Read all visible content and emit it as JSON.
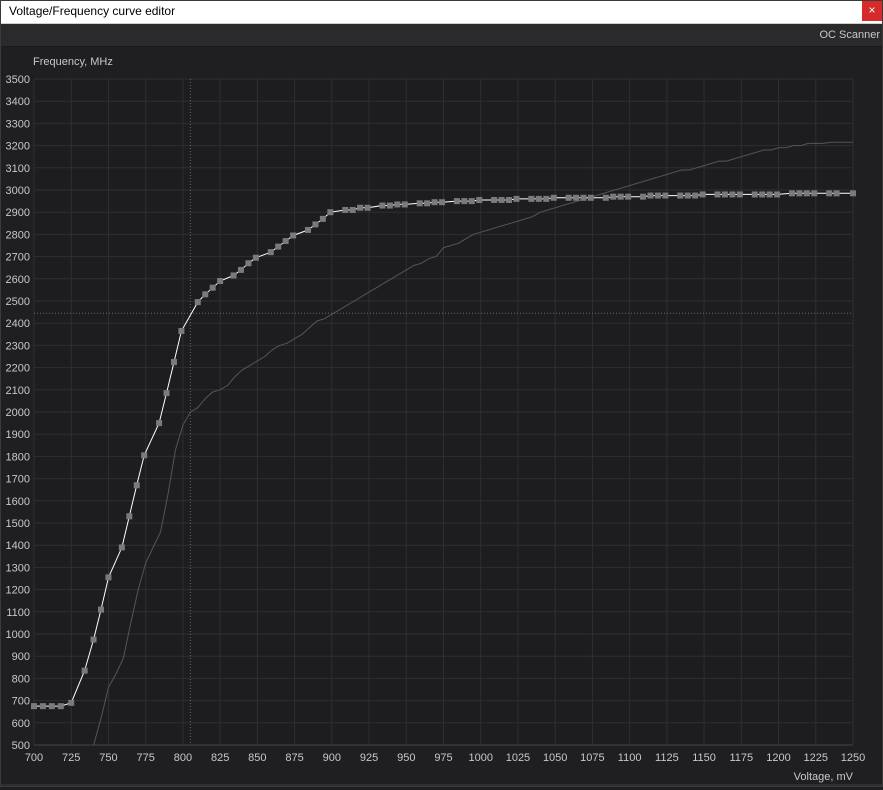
{
  "window": {
    "title": "Voltage/Frequency curve editor",
    "close_label": "×"
  },
  "toolbar": {
    "oc_scanner_label": "OC Scanner"
  },
  "colors": {
    "background": "#1f1f21",
    "grid": "#2f2f32",
    "curve": "#ffffff",
    "point": "#7a7a7a",
    "reference_curve": "#555555",
    "cursor_line": "#6a6a6a",
    "text": "#c8c8c8"
  },
  "chart_data": {
    "type": "line",
    "ylabel": "Frequency, MHz",
    "xlabel": "Voltage, mV",
    "xlim": [
      700,
      1250
    ],
    "ylim": [
      500,
      3500
    ],
    "xticks": [
      700,
      725,
      750,
      775,
      800,
      825,
      850,
      875,
      900,
      925,
      950,
      975,
      1000,
      1025,
      1050,
      1075,
      1100,
      1125,
      1150,
      1175,
      1200,
      1225,
      1250
    ],
    "yticks": [
      500,
      600,
      700,
      800,
      900,
      1000,
      1100,
      1200,
      1300,
      1400,
      1500,
      1600,
      1700,
      1800,
      1900,
      2000,
      2100,
      2200,
      2300,
      2400,
      2500,
      2600,
      2700,
      2800,
      2900,
      3000,
      3100,
      3200,
      3300,
      3400,
      3500
    ],
    "grid": true,
    "cursor": {
      "x": 805,
      "y": 2445
    },
    "series": [
      {
        "role": "curve",
        "markers": true,
        "points": [
          [
            700,
            675
          ],
          [
            706,
            675
          ],
          [
            712,
            675
          ],
          [
            718,
            675
          ],
          [
            725,
            690
          ],
          [
            734,
            835
          ],
          [
            740,
            975
          ],
          [
            745,
            1110
          ],
          [
            750,
            1255
          ],
          [
            759,
            1390
          ],
          [
            764,
            1530
          ],
          [
            769,
            1670
          ],
          [
            774,
            1805
          ],
          [
            784,
            1950
          ],
          [
            789,
            2085
          ],
          [
            794,
            2225
          ],
          [
            799,
            2365
          ],
          [
            810,
            2495
          ],
          [
            815,
            2530
          ],
          [
            820,
            2560
          ],
          [
            825,
            2590
          ],
          [
            834,
            2615
          ],
          [
            839,
            2640
          ],
          [
            844,
            2670
          ],
          [
            849,
            2695
          ],
          [
            859,
            2720
          ],
          [
            864,
            2745
          ],
          [
            869,
            2770
          ],
          [
            874,
            2795
          ],
          [
            884,
            2820
          ],
          [
            889,
            2845
          ],
          [
            894,
            2870
          ],
          [
            899,
            2900
          ],
          [
            909,
            2910
          ],
          [
            914,
            2910
          ],
          [
            919,
            2920
          ],
          [
            924,
            2920
          ],
          [
            934,
            2930
          ],
          [
            939,
            2930
          ],
          [
            944,
            2935
          ],
          [
            949,
            2935
          ],
          [
            959,
            2940
          ],
          [
            964,
            2940
          ],
          [
            969,
            2945
          ],
          [
            974,
            2945
          ],
          [
            984,
            2950
          ],
          [
            989,
            2950
          ],
          [
            994,
            2950
          ],
          [
            999,
            2955
          ],
          [
            1009,
            2955
          ],
          [
            1014,
            2955
          ],
          [
            1019,
            2955
          ],
          [
            1024,
            2960
          ],
          [
            1034,
            2960
          ],
          [
            1039,
            2960
          ],
          [
            1044,
            2960
          ],
          [
            1049,
            2965
          ],
          [
            1059,
            2965
          ],
          [
            1064,
            2965
          ],
          [
            1069,
            2965
          ],
          [
            1074,
            2965
          ],
          [
            1084,
            2965
          ],
          [
            1089,
            2970
          ],
          [
            1094,
            2970
          ],
          [
            1099,
            2970
          ],
          [
            1109,
            2970
          ],
          [
            1114,
            2975
          ],
          [
            1119,
            2975
          ],
          [
            1124,
            2975
          ],
          [
            1134,
            2975
          ],
          [
            1139,
            2975
          ],
          [
            1144,
            2975
          ],
          [
            1149,
            2980
          ],
          [
            1159,
            2980
          ],
          [
            1164,
            2980
          ],
          [
            1169,
            2980
          ],
          [
            1174,
            2980
          ],
          [
            1184,
            2980
          ],
          [
            1189,
            2980
          ],
          [
            1194,
            2980
          ],
          [
            1199,
            2980
          ],
          [
            1209,
            2985
          ],
          [
            1214,
            2985
          ],
          [
            1219,
            2985
          ],
          [
            1224,
            2985
          ],
          [
            1234,
            2985
          ],
          [
            1239,
            2985
          ],
          [
            1250,
            2985
          ]
        ]
      },
      {
        "role": "reference",
        "markers": false,
        "points": [
          [
            740,
            500
          ],
          [
            745,
            620
          ],
          [
            750,
            760
          ],
          [
            755,
            820
          ],
          [
            760,
            890
          ],
          [
            765,
            1050
          ],
          [
            770,
            1200
          ],
          [
            775,
            1320
          ],
          [
            780,
            1390
          ],
          [
            785,
            1460
          ],
          [
            790,
            1630
          ],
          [
            795,
            1830
          ],
          [
            800,
            1940
          ],
          [
            805,
            2000
          ],
          [
            810,
            2020
          ],
          [
            815,
            2060
          ],
          [
            820,
            2090
          ],
          [
            825,
            2100
          ],
          [
            830,
            2120
          ],
          [
            835,
            2160
          ],
          [
            840,
            2190
          ],
          [
            845,
            2210
          ],
          [
            850,
            2230
          ],
          [
            855,
            2250
          ],
          [
            860,
            2280
          ],
          [
            865,
            2300
          ],
          [
            870,
            2310
          ],
          [
            875,
            2330
          ],
          [
            880,
            2350
          ],
          [
            885,
            2380
          ],
          [
            890,
            2410
          ],
          [
            895,
            2420
          ],
          [
            900,
            2440
          ],
          [
            905,
            2460
          ],
          [
            910,
            2480
          ],
          [
            915,
            2500
          ],
          [
            920,
            2520
          ],
          [
            925,
            2540
          ],
          [
            930,
            2560
          ],
          [
            935,
            2580
          ],
          [
            940,
            2600
          ],
          [
            945,
            2620
          ],
          [
            950,
            2640
          ],
          [
            955,
            2660
          ],
          [
            960,
            2670
          ],
          [
            965,
            2690
          ],
          [
            970,
            2700
          ],
          [
            975,
            2740
          ],
          [
            980,
            2750
          ],
          [
            985,
            2760
          ],
          [
            990,
            2780
          ],
          [
            995,
            2800
          ],
          [
            1000,
            2810
          ],
          [
            1005,
            2820
          ],
          [
            1010,
            2830
          ],
          [
            1015,
            2840
          ],
          [
            1020,
            2850
          ],
          [
            1025,
            2860
          ],
          [
            1030,
            2870
          ],
          [
            1035,
            2880
          ],
          [
            1040,
            2900
          ],
          [
            1045,
            2910
          ],
          [
            1050,
            2920
          ],
          [
            1055,
            2930
          ],
          [
            1060,
            2940
          ],
          [
            1065,
            2950
          ],
          [
            1070,
            2960
          ],
          [
            1075,
            2970
          ],
          [
            1080,
            2980
          ],
          [
            1085,
            2990
          ],
          [
            1090,
            3000
          ],
          [
            1095,
            3010
          ],
          [
            1100,
            3020
          ],
          [
            1105,
            3030
          ],
          [
            1110,
            3040
          ],
          [
            1115,
            3050
          ],
          [
            1120,
            3060
          ],
          [
            1125,
            3070
          ],
          [
            1130,
            3080
          ],
          [
            1135,
            3090
          ],
          [
            1140,
            3090
          ],
          [
            1145,
            3100
          ],
          [
            1150,
            3110
          ],
          [
            1155,
            3120
          ],
          [
            1160,
            3130
          ],
          [
            1165,
            3130
          ],
          [
            1170,
            3140
          ],
          [
            1175,
            3150
          ],
          [
            1180,
            3160
          ],
          [
            1185,
            3170
          ],
          [
            1190,
            3180
          ],
          [
            1195,
            3180
          ],
          [
            1200,
            3190
          ],
          [
            1205,
            3190
          ],
          [
            1210,
            3200
          ],
          [
            1215,
            3200
          ],
          [
            1220,
            3210
          ],
          [
            1225,
            3210
          ],
          [
            1230,
            3210
          ],
          [
            1235,
            3215
          ],
          [
            1240,
            3215
          ],
          [
            1245,
            3215
          ],
          [
            1250,
            3215
          ]
        ]
      }
    ]
  }
}
